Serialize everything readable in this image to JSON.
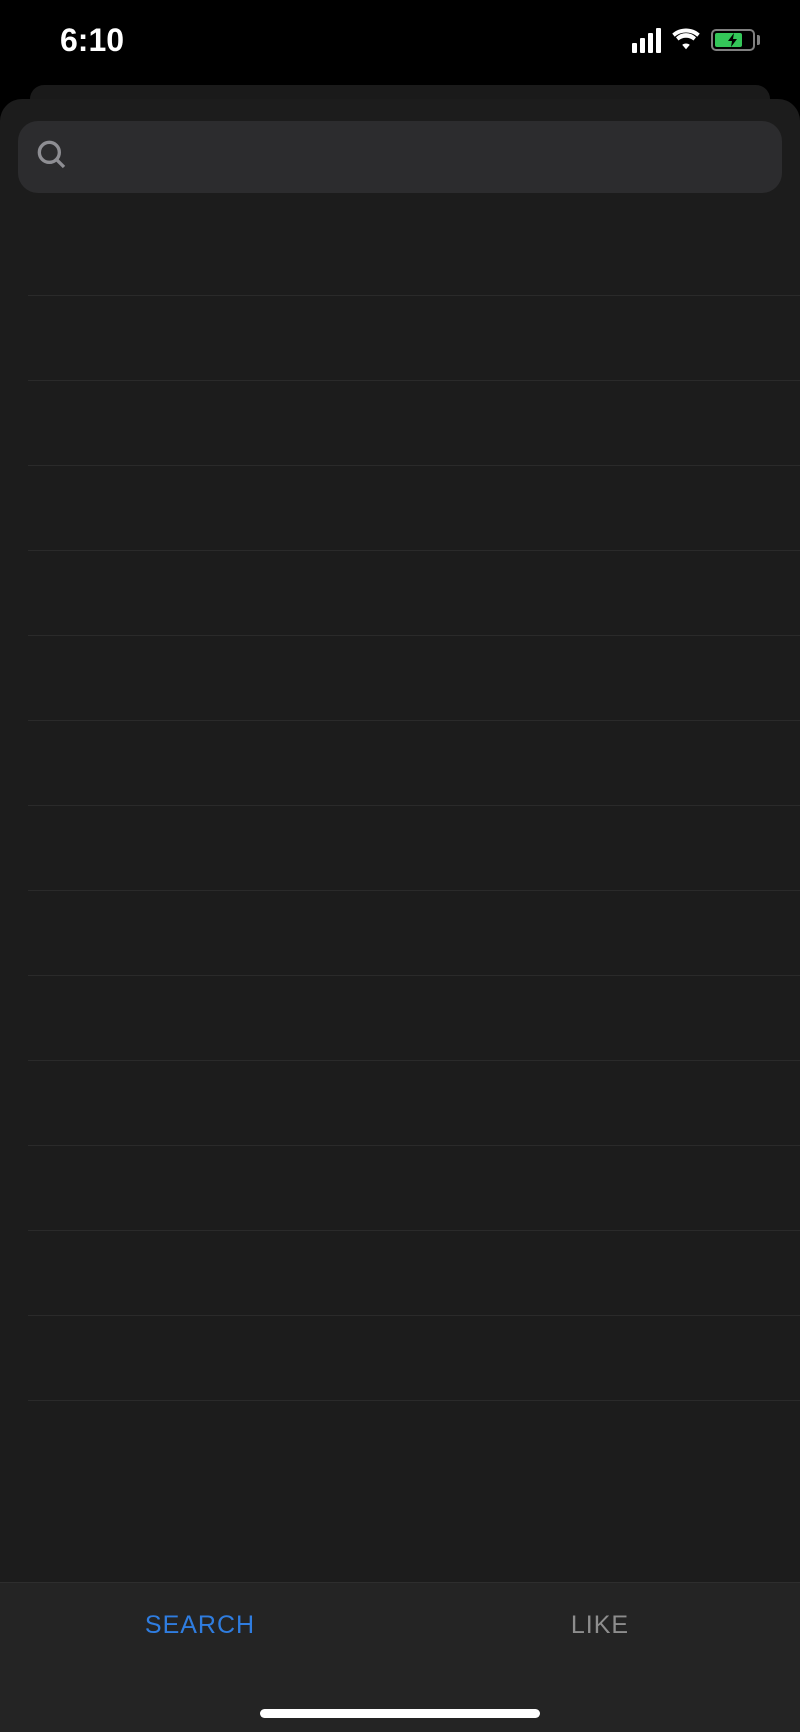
{
  "status_bar": {
    "time": "6:10"
  },
  "search": {
    "placeholder": ""
  },
  "list": {
    "rows": [
      "",
      "",
      "",
      "",
      "",
      "",
      "",
      "",
      "",
      "",
      "",
      "",
      "",
      ""
    ]
  },
  "tabs": {
    "search": "SEARCH",
    "like": "LIKE",
    "active": "search"
  }
}
